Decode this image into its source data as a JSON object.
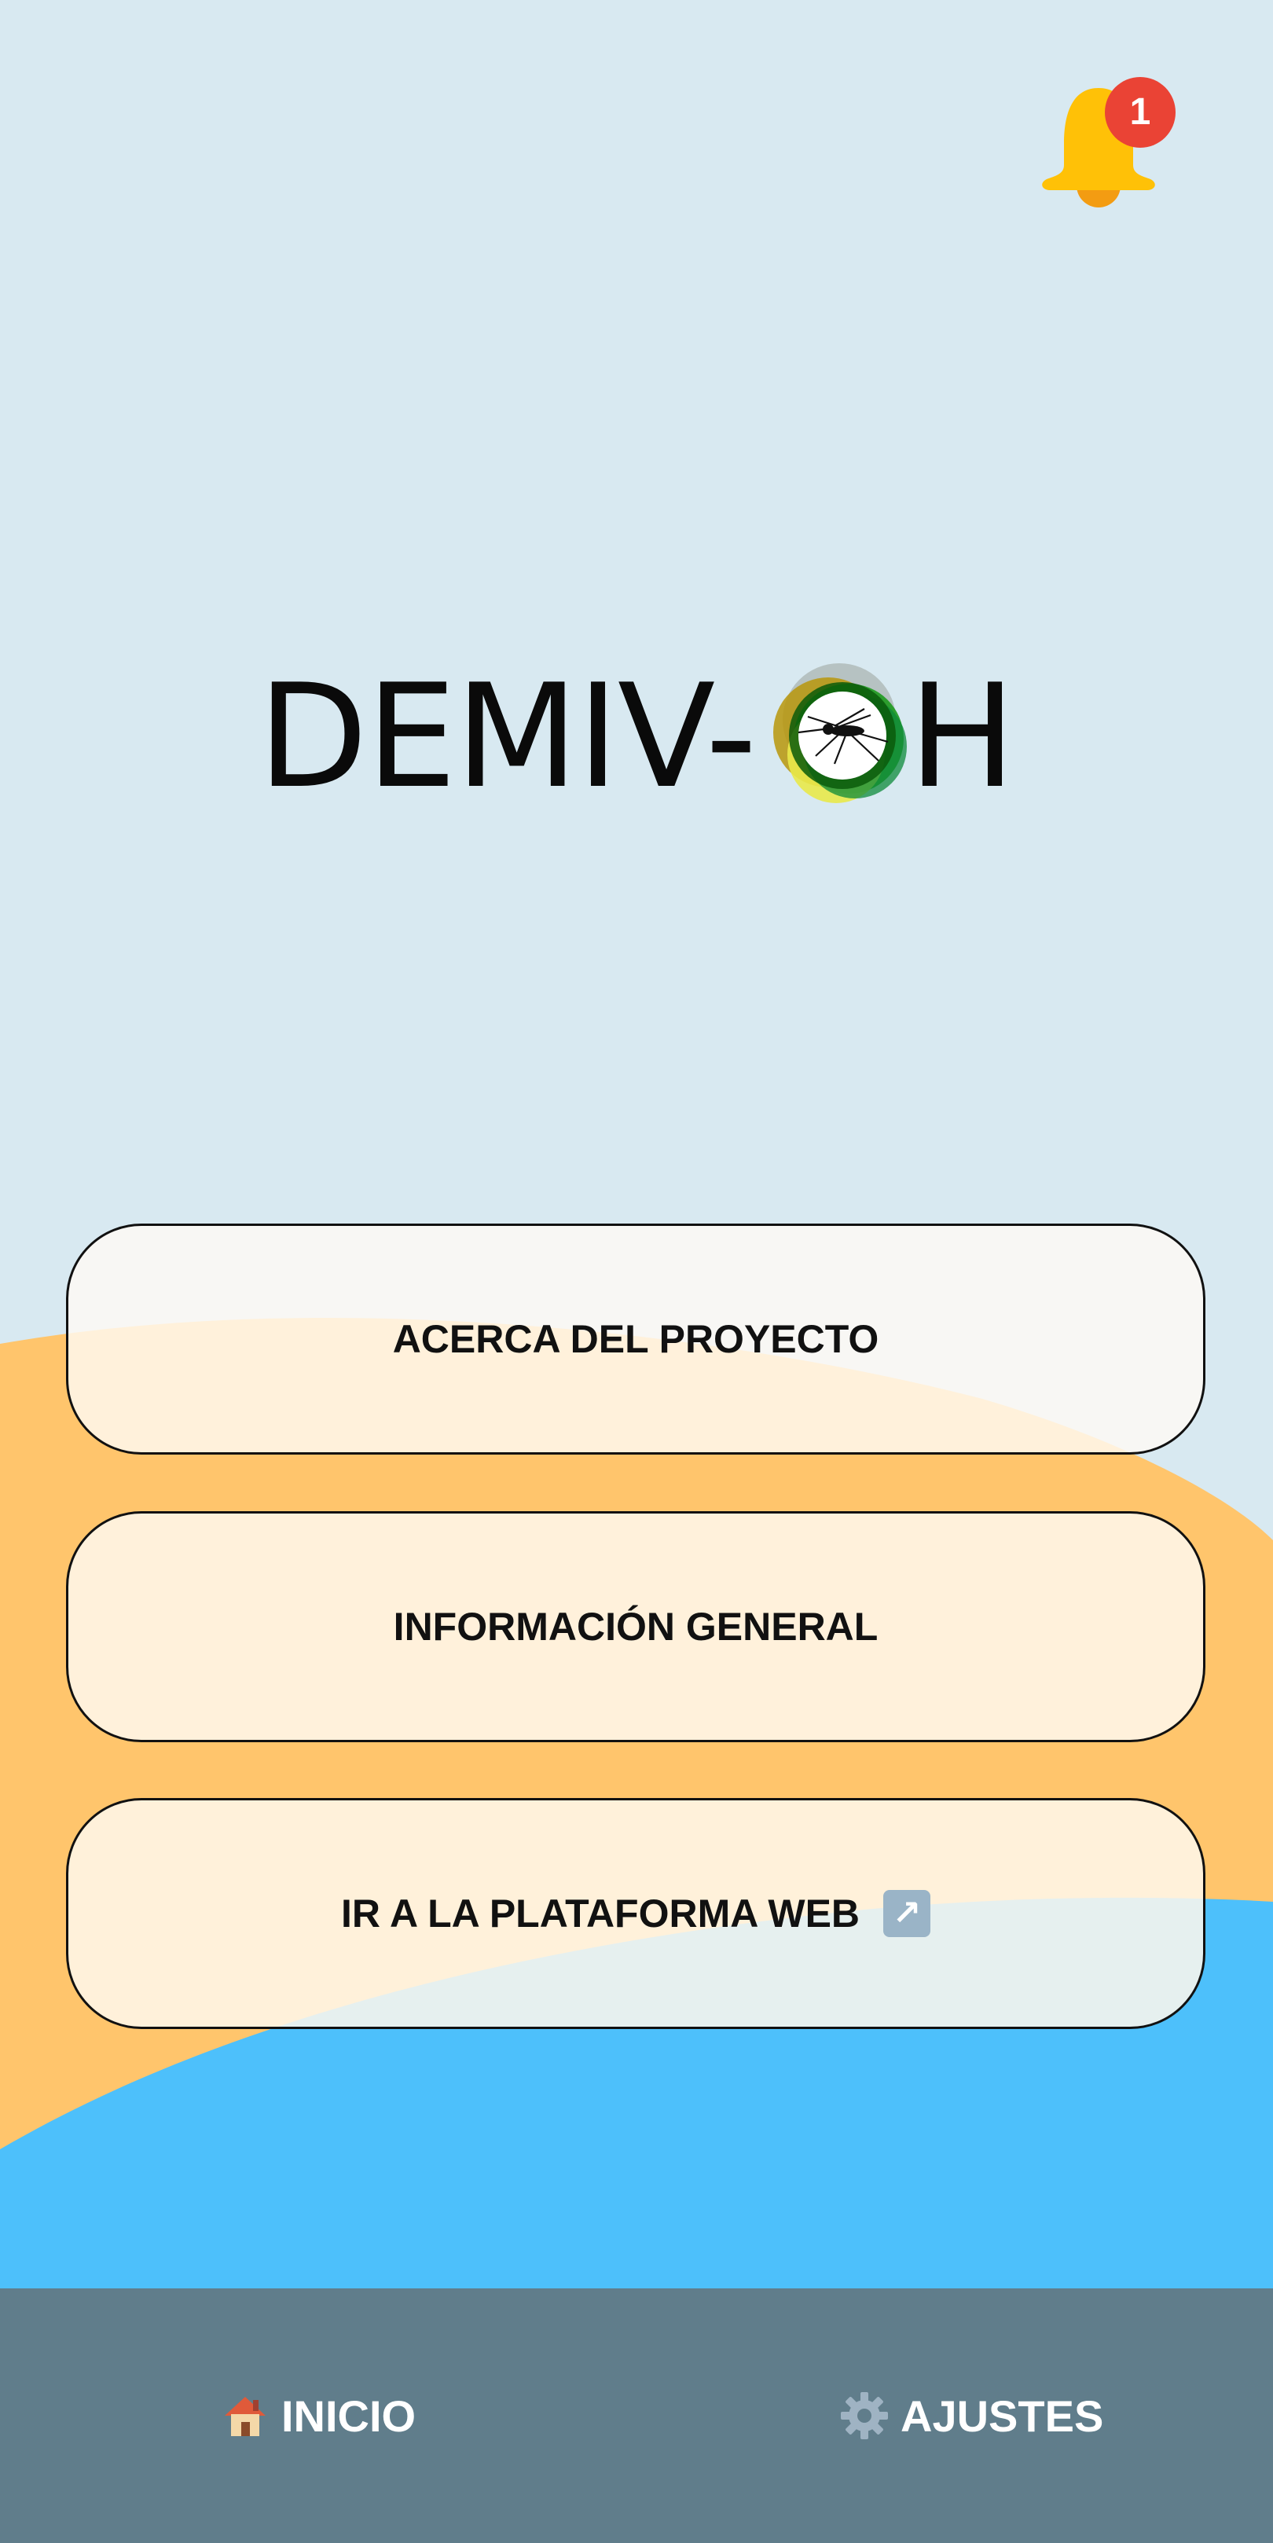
{
  "app": {
    "logo_left": "DEMIV-",
    "logo_right": "H"
  },
  "notifications": {
    "count": "1",
    "icon": "bell-icon"
  },
  "menu": {
    "items": [
      {
        "label": "ACERCA DEL PROYECTO"
      },
      {
        "label": "INFORMACIÓN GENERAL"
      },
      {
        "label": "IR A LA PLATAFORMA WEB",
        "icon": "external-link-icon"
      }
    ]
  },
  "nav": {
    "home_label": "INICIO",
    "home_icon": "house-icon",
    "settings_label": "AJUSTES",
    "settings_icon": "gear-icon"
  },
  "colors": {
    "sky": "#d8e9f1",
    "sand": "#ffc56c",
    "water": "#4dc0fb",
    "nav_bar": "#607d8b",
    "bell": "#ffc107",
    "badge": "#ea4335"
  }
}
